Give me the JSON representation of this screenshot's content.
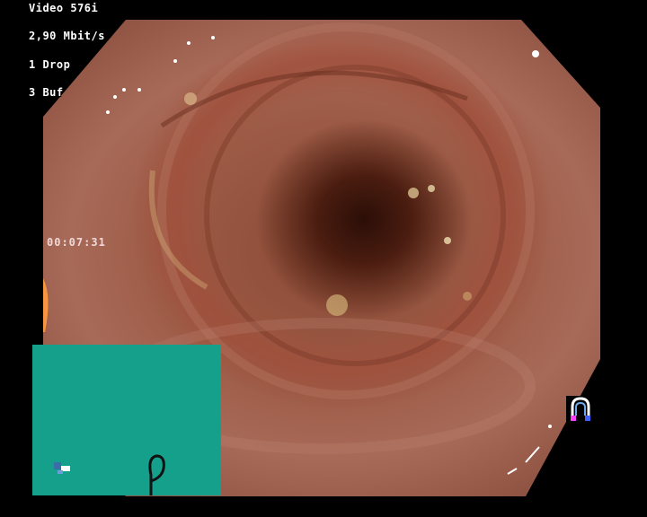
{
  "status_overlay": {
    "video_mode": "Video 576i",
    "bitrate": "2,90 Mbit/s",
    "dropped": "1 Drop",
    "buffer": "3 Buf"
  },
  "timestamp": "00:07:31",
  "icons": {
    "scope_shape": "endoscope-loop-icon",
    "camera_position": "scope-tip-marker-icon",
    "capture_indicator": "magnet-u-icon"
  },
  "colors": {
    "minimap_background": "#14a08a",
    "overlay_text": "#ffffff",
    "mucosa": "#9c5b46",
    "lumen": "#2b0e07"
  }
}
